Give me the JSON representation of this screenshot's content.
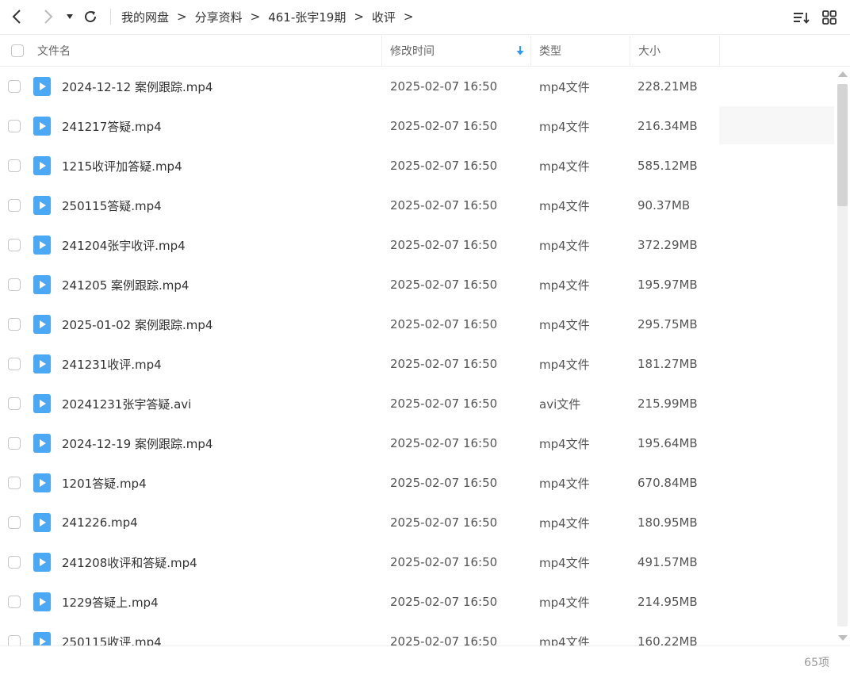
{
  "toolbar": {
    "breadcrumbs": [
      "我的网盘",
      "分享资料",
      "461-张宇19期",
      "收评"
    ],
    "separator": ">"
  },
  "header": {
    "name": "文件名",
    "time": "修改时间",
    "type": "类型",
    "size": "大小",
    "sorted_column": "修改时间",
    "sort_direction": "descending"
  },
  "files": [
    {
      "name": "2024-12-12 案例跟踪.mp4",
      "time": "2025-02-07 16:50",
      "type": "mp4文件",
      "size": "228.21MB"
    },
    {
      "name": "241217答疑.mp4",
      "time": "2025-02-07 16:50",
      "type": "mp4文件",
      "size": "216.34MB"
    },
    {
      "name": "1215收评加答疑.mp4",
      "time": "2025-02-07 16:50",
      "type": "mp4文件",
      "size": "585.12MB"
    },
    {
      "name": "250115答疑.mp4",
      "time": "2025-02-07 16:50",
      "type": "mp4文件",
      "size": "90.37MB"
    },
    {
      "name": "241204张宇收评.mp4",
      "time": "2025-02-07 16:50",
      "type": "mp4文件",
      "size": "372.29MB"
    },
    {
      "name": "241205 案例跟踪.mp4",
      "time": "2025-02-07 16:50",
      "type": "mp4文件",
      "size": "195.97MB"
    },
    {
      "name": "2025-01-02 案例跟踪.mp4",
      "time": "2025-02-07 16:50",
      "type": "mp4文件",
      "size": "295.75MB"
    },
    {
      "name": "241231收评.mp4",
      "time": "2025-02-07 16:50",
      "type": "mp4文件",
      "size": "181.27MB"
    },
    {
      "name": "20241231张宇答疑.avi",
      "time": "2025-02-07 16:50",
      "type": "avi文件",
      "size": "215.99MB"
    },
    {
      "name": "2024-12-19 案例跟踪.mp4",
      "time": "2025-02-07 16:50",
      "type": "mp4文件",
      "size": "195.64MB"
    },
    {
      "name": "1201答疑.mp4",
      "time": "2025-02-07 16:50",
      "type": "mp4文件",
      "size": "670.84MB"
    },
    {
      "name": "241226.mp4",
      "time": "2025-02-07 16:50",
      "type": "mp4文件",
      "size": "180.95MB"
    },
    {
      "name": "241208收评和答疑.mp4",
      "time": "2025-02-07 16:50",
      "type": "mp4文件",
      "size": "491.57MB"
    },
    {
      "name": "1229答疑上.mp4",
      "time": "2025-02-07 16:50",
      "type": "mp4文件",
      "size": "214.95MB"
    },
    {
      "name": "250115收评.mp4",
      "time": "2025-02-07 16:50",
      "type": "mp4文件",
      "size": "160.22MB"
    }
  ],
  "footer": {
    "count": "65项"
  },
  "colors": {
    "accent": "#2b9af3",
    "file_icon": "#4aa8f5"
  },
  "icons": {
    "back": "chevron-left-icon",
    "forward": "chevron-right-icon",
    "history": "caret-down-icon",
    "refresh": "refresh-icon",
    "sort": "sort-list-icon",
    "grid": "grid-view-icon",
    "file": "video-file-icon"
  }
}
